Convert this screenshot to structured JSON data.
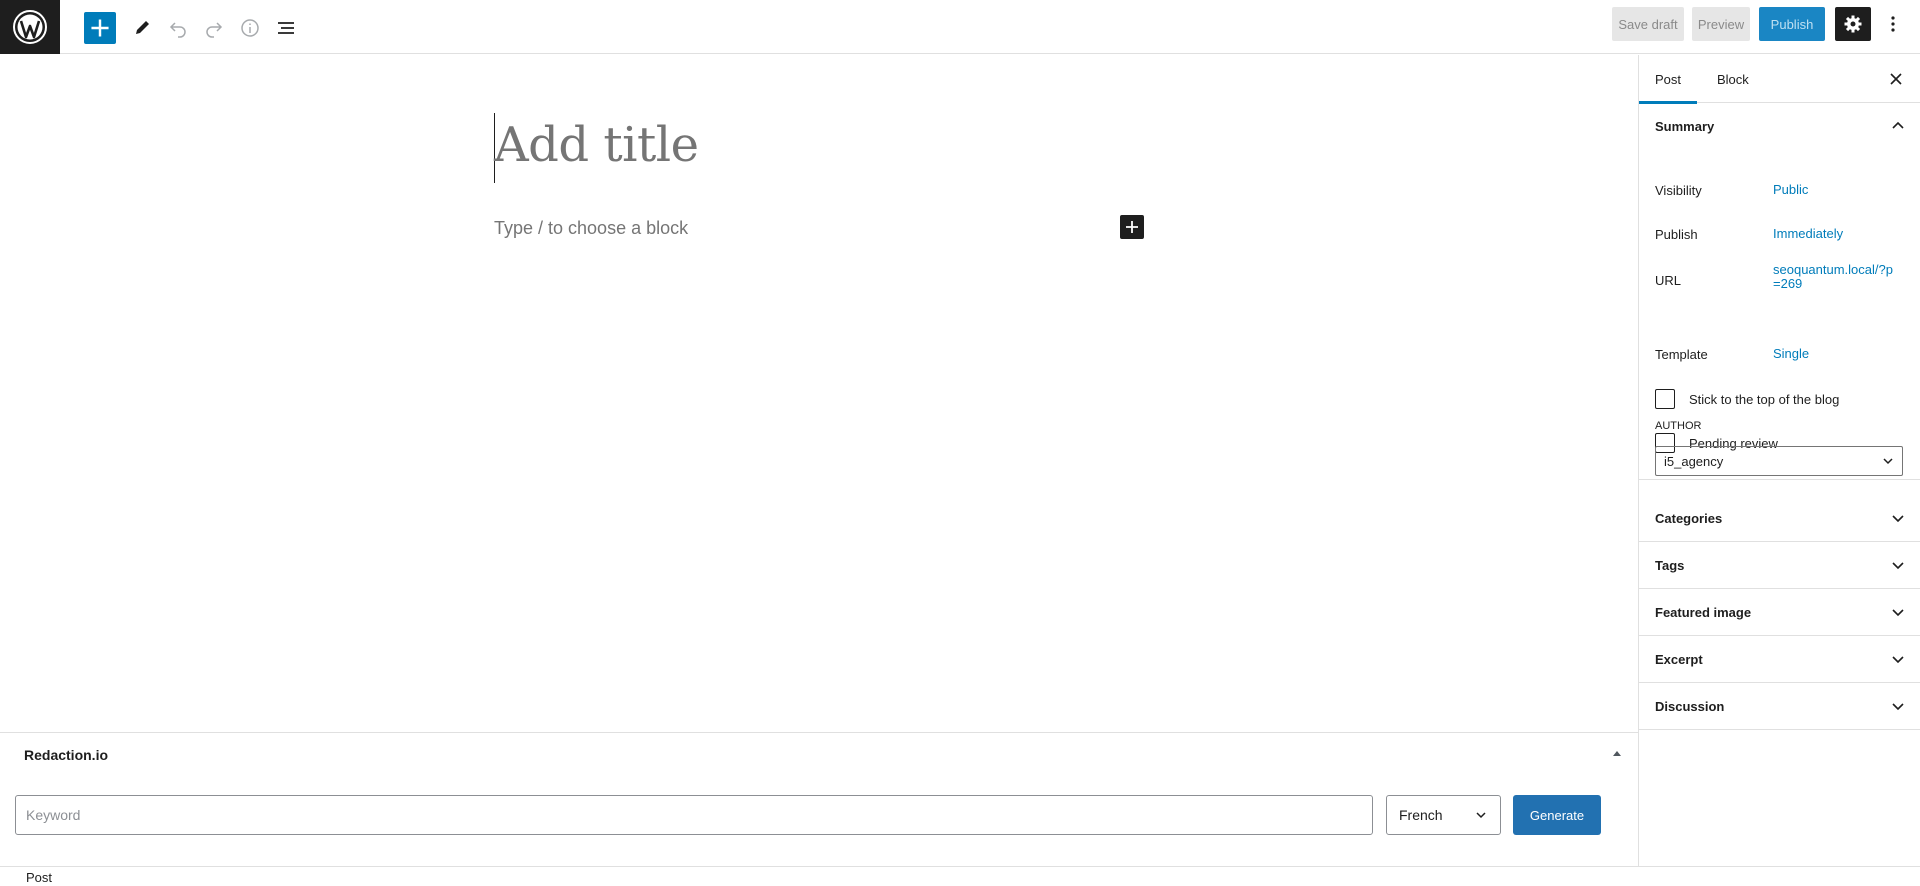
{
  "toolbar": {
    "save_draft": "Save draft",
    "preview": "Preview",
    "publish": "Publish"
  },
  "editor": {
    "title_placeholder": "Add title",
    "block_placeholder": "Type / to choose a block"
  },
  "metabox": {
    "title": "Redaction.io",
    "keyword_placeholder": "Keyword",
    "language": "French",
    "generate": "Generate"
  },
  "footer": {
    "breadcrumb": "Post"
  },
  "sidebar": {
    "tabs": [
      "Post",
      "Block"
    ],
    "summary_title": "Summary",
    "visibility_label": "Visibility",
    "visibility_value": "Public",
    "publish_label": "Publish",
    "publish_value": "Immediately",
    "url_label": "URL",
    "url_value": "seoquantum.local/?p=269",
    "template_label": "Template",
    "template_value": "Single",
    "sticky_label": "Stick to the top of the blog",
    "pending_label": "Pending review",
    "author_label": "AUTHOR",
    "author_value": "i5_agency",
    "panels": [
      "Categories",
      "Tags",
      "Featured image",
      "Excerpt",
      "Discussion"
    ]
  },
  "colors": {
    "accent": "#007cba",
    "dark": "#1e1e1e",
    "generate": "#2271b1"
  },
  "icons": [
    "wordpress-logo-icon",
    "plus-icon",
    "pencil-icon",
    "undo-icon",
    "redo-icon",
    "info-icon",
    "list-view-icon",
    "gear-icon",
    "more-vertical-icon",
    "close-icon",
    "chevron-up-icon",
    "chevron-down-icon",
    "caret-up-icon"
  ]
}
